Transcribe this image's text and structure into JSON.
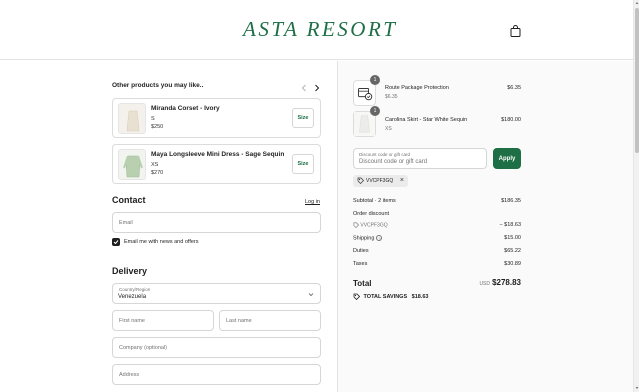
{
  "brand": {
    "logo_text": "ASTA RESORT",
    "accent_color": "#1e6e46"
  },
  "header": {
    "cart_icon": "shopping-bag-icon"
  },
  "recommendations": {
    "title": "Other products you may like..",
    "products": [
      {
        "name": "Miranda Corset - Ivory",
        "size": "S",
        "price": "$250",
        "size_button": "Size"
      },
      {
        "name": "Maya Longsleeve Mini Dress - Sage Sequin",
        "size": "XS",
        "price": "$270",
        "size_button": "Size"
      }
    ]
  },
  "contact": {
    "heading": "Contact",
    "login_link": "Log in",
    "email_placeholder": "Email",
    "newsletter_label": "Email me with news and offers",
    "newsletter_checked": true
  },
  "delivery": {
    "heading": "Delivery",
    "country_label": "Country/Region",
    "country_value": "Venezuela",
    "first_name_placeholder": "First name",
    "last_name_placeholder": "Last name",
    "company_placeholder": "Company (optional)",
    "address_placeholder": "Address"
  },
  "order_summary": {
    "items": [
      {
        "name": "Route Package Protection",
        "variant": "$6.35",
        "price": "$6.35",
        "quantity": "1"
      },
      {
        "name": "Carolina Skirt - Star White Sequin",
        "variant": "XS",
        "price": "$180.00",
        "quantity": "1"
      }
    ],
    "discount": {
      "field_label": "Discount code or gift card",
      "placeholder": "Discount code or gift card",
      "apply_label": "Apply",
      "applied_code": "VVCPF3GQ",
      "remove_symbol": "×"
    },
    "subtotal_label": "Subtotal · 2 items",
    "subtotal_value": "$186.35",
    "order_discount_label": "Order discount",
    "order_discount_code": "VVCPF3GQ",
    "order_discount_value": "− $18.63",
    "shipping_label": "Shipping",
    "shipping_value": "$15.00",
    "duties_label": "Duties",
    "duties_value": "$65.22",
    "taxes_label": "Taxes",
    "taxes_value": "$30.89",
    "total_label": "Total",
    "total_currency": "USD",
    "total_value": "$278.83",
    "savings_label": "TOTAL SAVINGS",
    "savings_value": "$18.63"
  }
}
